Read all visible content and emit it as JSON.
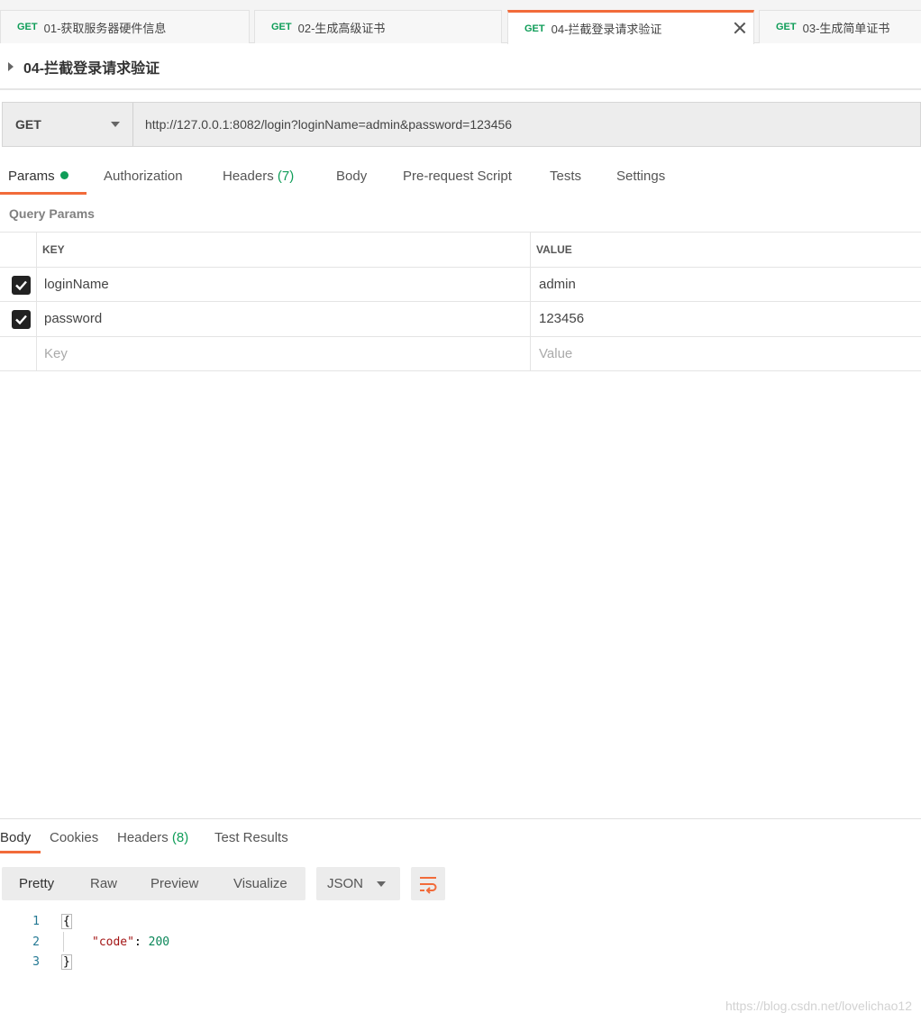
{
  "tabs": [
    {
      "method": "GET",
      "name": "01-获取服务器硬件信息"
    },
    {
      "method": "GET",
      "name": "02-生成高级证书"
    },
    {
      "method": "GET",
      "name": "04-拦截登录请求验证"
    },
    {
      "method": "GET",
      "name": "03-生成简单证书"
    }
  ],
  "request": {
    "title": "04-拦截登录请求验证",
    "method": "GET",
    "url": "http://127.0.0.1:8082/login?loginName=admin&password=123456"
  },
  "request_tabs": {
    "params": "Params",
    "authorization": "Authorization",
    "headers": "Headers",
    "headers_count": "(7)",
    "body": "Body",
    "prerequest": "Pre-request Script",
    "tests": "Tests",
    "settings": "Settings"
  },
  "query_params": {
    "label": "Query Params",
    "key_header": "KEY",
    "value_header": "VALUE",
    "rows": [
      {
        "key": "loginName",
        "value": "admin"
      },
      {
        "key": "password",
        "value": "123456"
      }
    ],
    "key_placeholder": "Key",
    "value_placeholder": "Value"
  },
  "response_tabs": {
    "body": "Body",
    "cookies": "Cookies",
    "headers": "Headers",
    "headers_count": "(8)",
    "test_results": "Test Results"
  },
  "view_modes": {
    "pretty": "Pretty",
    "raw": "Raw",
    "preview": "Preview",
    "visualize": "Visualize",
    "format": "JSON"
  },
  "response_body": {
    "line1": "1",
    "line2": "2",
    "line3": "3",
    "open_brace": "{",
    "key": "\"code\"",
    "colon": ": ",
    "value": "200",
    "close_brace": "}"
  },
  "watermark": "https://blog.csdn.net/lovelichao12",
  "colors": {
    "accent": "#f26b3a",
    "get_method": "#0f9d58"
  }
}
